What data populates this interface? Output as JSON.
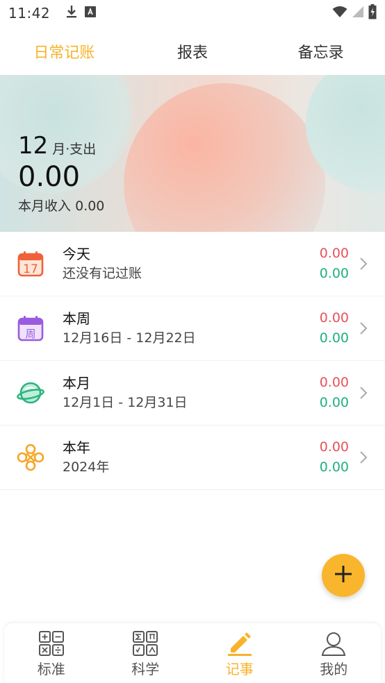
{
  "status_bar": {
    "time": "11:42"
  },
  "top_tabs": [
    {
      "label": "日常记账",
      "active": true
    },
    {
      "label": "报表",
      "active": false
    },
    {
      "label": "备忘录",
      "active": false
    }
  ],
  "banner": {
    "month": "12",
    "month_suffix": "月·支出",
    "expense": "0.00",
    "income_label": "本月收入",
    "income_value": "0.00"
  },
  "summary": [
    {
      "title": "今天",
      "subtitle": "还没有记过账",
      "expense": "0.00",
      "income": "0.00",
      "icon": "calendar-today-icon",
      "icon_text": "17"
    },
    {
      "title": "本周",
      "subtitle": "12月16日 - 12月22日",
      "expense": "0.00",
      "income": "0.00",
      "icon": "calendar-week-icon",
      "icon_text": "周"
    },
    {
      "title": "本月",
      "subtitle": "12月1日 - 12月31日",
      "expense": "0.00",
      "income": "0.00",
      "icon": "planet-icon"
    },
    {
      "title": "本年",
      "subtitle": "2024年",
      "expense": "0.00",
      "income": "0.00",
      "icon": "knot-icon"
    }
  ],
  "colors": {
    "accent": "#f7b32b",
    "expense": "#e5535b",
    "income": "#1fb07e"
  },
  "bottom_nav": [
    {
      "label": "标准",
      "icon": "standard-calculator-icon",
      "active": false
    },
    {
      "label": "科学",
      "icon": "scientific-calculator-icon",
      "active": false
    },
    {
      "label": "记事",
      "icon": "pencil-icon",
      "active": true
    },
    {
      "label": "我的",
      "icon": "profile-icon",
      "active": false
    }
  ]
}
